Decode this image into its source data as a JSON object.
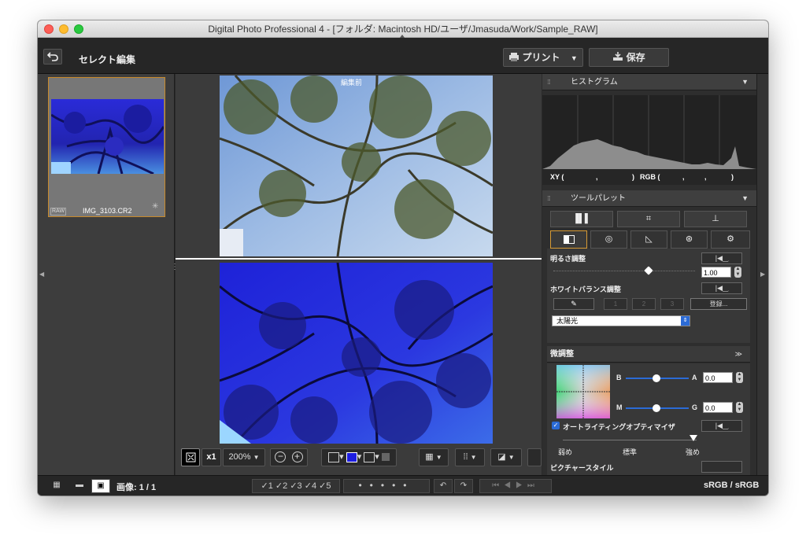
{
  "window": {
    "title": "Digital Photo Professional 4 - [フォルダ: Macintosh HD/ユーザ/Jmasuda/Work/Sample_RAW]"
  },
  "toolbar": {
    "back_icon": "return-arrow-icon",
    "mode_title": "セレクト編集",
    "print_label": "プリント",
    "save_label": "保存"
  },
  "thumbnail": {
    "raw_badge": "RAW",
    "filename": "IMG_3103.CR2"
  },
  "viewer": {
    "before_label": "編集前"
  },
  "viewbar": {
    "fit_icon": "fit-screen-icon",
    "x1_label": "x1",
    "zoom_value": "200%",
    "zoom_out_icon": "zoom-out-icon",
    "zoom_in_icon": "zoom-in-icon"
  },
  "histogram": {
    "title": "ヒストグラム",
    "xy_label": "XY (",
    "xy_sep": ",",
    "xy_close": ")",
    "rgb_label": "RGB (",
    "rgb_sep1": ",",
    "rgb_sep2": ",",
    "rgb_close": ")"
  },
  "tool_palette": {
    "title": "ツールパレット",
    "brightness_label": "明るさ調整",
    "brightness_value": "1.00",
    "brightness_level": 0.82,
    "white_balance_label": "ホワイトバランス調整",
    "wb_slots": [
      "1",
      "2",
      "3"
    ],
    "register_label": "登録...",
    "wb_preset": "太陽光",
    "fine_tune_label": "微調整",
    "b_label": "B",
    "a_label": "A",
    "a_value": "0.0",
    "m_label": "M",
    "g_label": "G",
    "g_value": "0.0",
    "alo_label": "オートライティングオプティマイザ",
    "alo_checked": true,
    "alo_levels": [
      "弱め",
      "標準",
      "強め"
    ],
    "alo_level": "強め",
    "picture_style_label": "ピクチャースタイル"
  },
  "statusbar": {
    "image_count": "画像: 1 / 1",
    "ratings": [
      "1",
      "2",
      "3",
      "4",
      "5"
    ],
    "color_space": "sRGB / sRGB"
  },
  "colors": {
    "accent_orange": "#d69a34",
    "select_blue": "#2b6bd6"
  }
}
